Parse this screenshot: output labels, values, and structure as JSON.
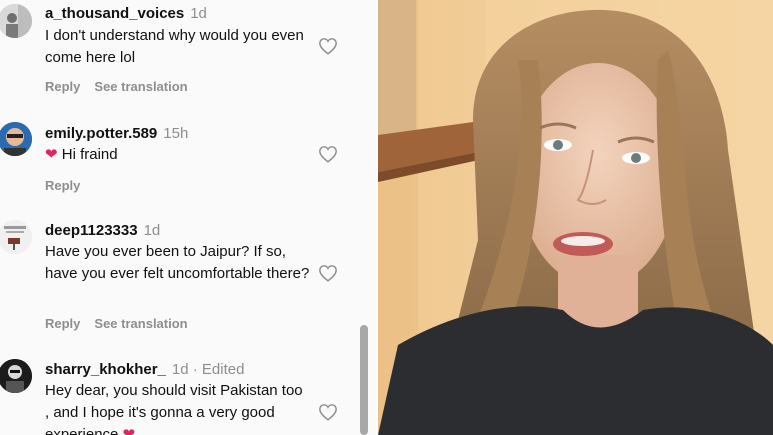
{
  "comments": [
    {
      "username": "a_thousand_voices",
      "time": "1d",
      "text": "I don't understand why would you even come here lol",
      "reply_label": "Reply",
      "translate_label": "See translation"
    },
    {
      "username": "emily.potter.589",
      "time": "15h",
      "text": "Hi fraind",
      "reply_label": "Reply"
    },
    {
      "username": "deep1123333",
      "time": "1d",
      "text": "Have you ever been to Jaipur? If so, have you ever felt uncomfortable there?",
      "reply_label": "Reply",
      "translate_label": "See translation"
    },
    {
      "username": "sharry_khokher_",
      "time": "1d · Edited",
      "text": "Hey dear, you should visit Pakistan too , and I hope it's gonna a very good experience"
    }
  ],
  "colors": {
    "secondary_text": "#8e8e8e",
    "emoji_heart": "#e0245e",
    "panel_bg": "#fafafa"
  },
  "icons": {
    "like": "heart-outline-icon",
    "emoji": "heart-emoji"
  }
}
